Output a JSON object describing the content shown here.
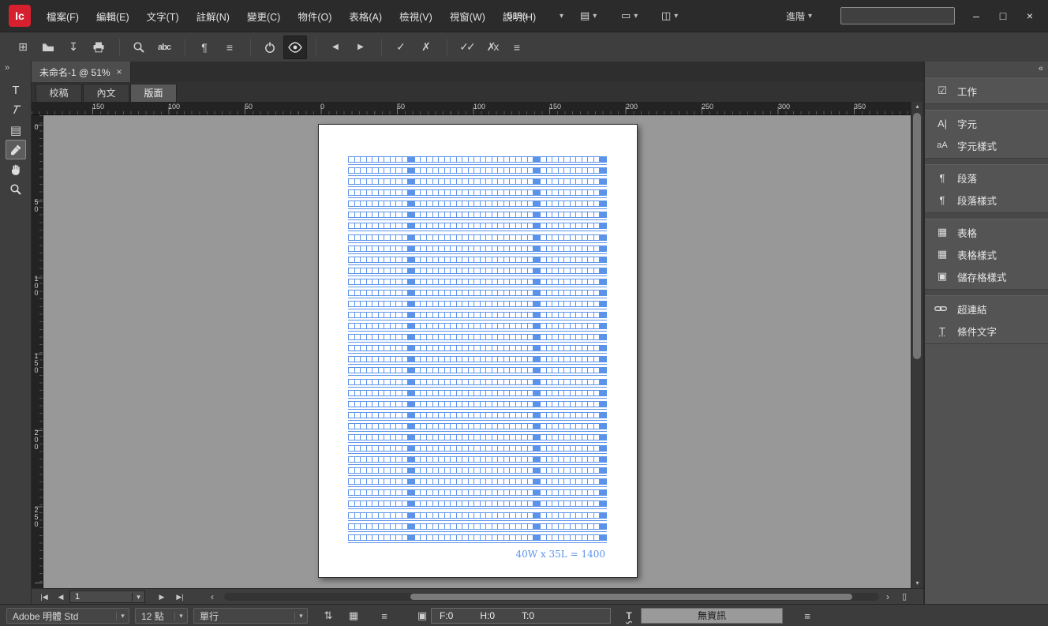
{
  "titlebar": {
    "logo": "Ic",
    "menus": [
      "檔案(F)",
      "編輯(E)",
      "文字(T)",
      "註解(N)",
      "變更(C)",
      "物件(O)",
      "表格(A)",
      "檢視(V)",
      "視窗(W)",
      "說明(H)"
    ],
    "zoom_level": "51%",
    "advanced_label": "進階",
    "search_value": ""
  },
  "document": {
    "tab_title": "未命名-1 @ 51%",
    "view_tabs": [
      "校稿",
      "內文",
      "版面"
    ],
    "active_view_tab": "版面"
  },
  "rulers": {
    "horizontal": [
      "150",
      "100",
      "50",
      "0",
      "50",
      "100",
      "150",
      "200",
      "250",
      "300",
      "350"
    ],
    "vertical": [
      "0",
      "50",
      "100",
      "150",
      "200",
      "250"
    ]
  },
  "page": {
    "grid": {
      "type": "manuscript-grid",
      "columns": 40,
      "lines": 35,
      "marker_after": [
        10,
        30,
        40
      ],
      "label": "40W x 35L = 1400",
      "color": "#5b93ea"
    }
  },
  "panel": {
    "items": [
      {
        "label": "工作",
        "icon": "☑"
      },
      {
        "label": "字元",
        "icon": "A|"
      },
      {
        "label": "字元樣式",
        "icon": "aA"
      },
      {
        "label": "段落",
        "icon": "¶"
      },
      {
        "label": "段落樣式",
        "icon": "¶"
      },
      {
        "label": "表格",
        "icon": "▦"
      },
      {
        "label": "表格樣式",
        "icon": "▦"
      },
      {
        "label": "儲存格樣式",
        "icon": "▣"
      },
      {
        "label": "超連結",
        "icon": "chain"
      },
      {
        "label": "條件文字",
        "icon": "T"
      }
    ]
  },
  "pagenav": {
    "current_page": "1"
  },
  "statusbar": {
    "font": "Adobe 明體 Std",
    "size": "12 點",
    "composer": "單行",
    "copyfit": {
      "f": "F:0",
      "h": "H:0",
      "t": "T:0"
    },
    "info": "無資訊"
  },
  "icons": {
    "new_document": "⊞",
    "save": "↧",
    "spellcheck": "abc",
    "hidden_chars": "¶",
    "menu": "≡",
    "prev_change": "◀",
    "next_change": "▶",
    "accept": "✓",
    "reject": "✗",
    "accept_all": "✓✓",
    "reject_all": "✗x",
    "expand": "»",
    "collapse": "«",
    "chevron_down": "▾",
    "view_options": "▤",
    "screen_mode": "▭",
    "arrange_documents": "◫",
    "first_page": "|◀",
    "prev_page": "◀",
    "next_page": "▶",
    "last_page": "▶|",
    "scroll_left": "‹",
    "scroll_right": "›",
    "scroll_up": "▴",
    "scroll_down": "▾",
    "spread": "▯",
    "note_tool": "▤",
    "type_tool": "T",
    "type_on_path_tool": "T",
    "direction": "⇅",
    "frame": "▦",
    "kinsoku": "▣",
    "underline_t": "T",
    "minimize": "–",
    "maximize": "□",
    "close": "×",
    "tab_close": "×"
  }
}
